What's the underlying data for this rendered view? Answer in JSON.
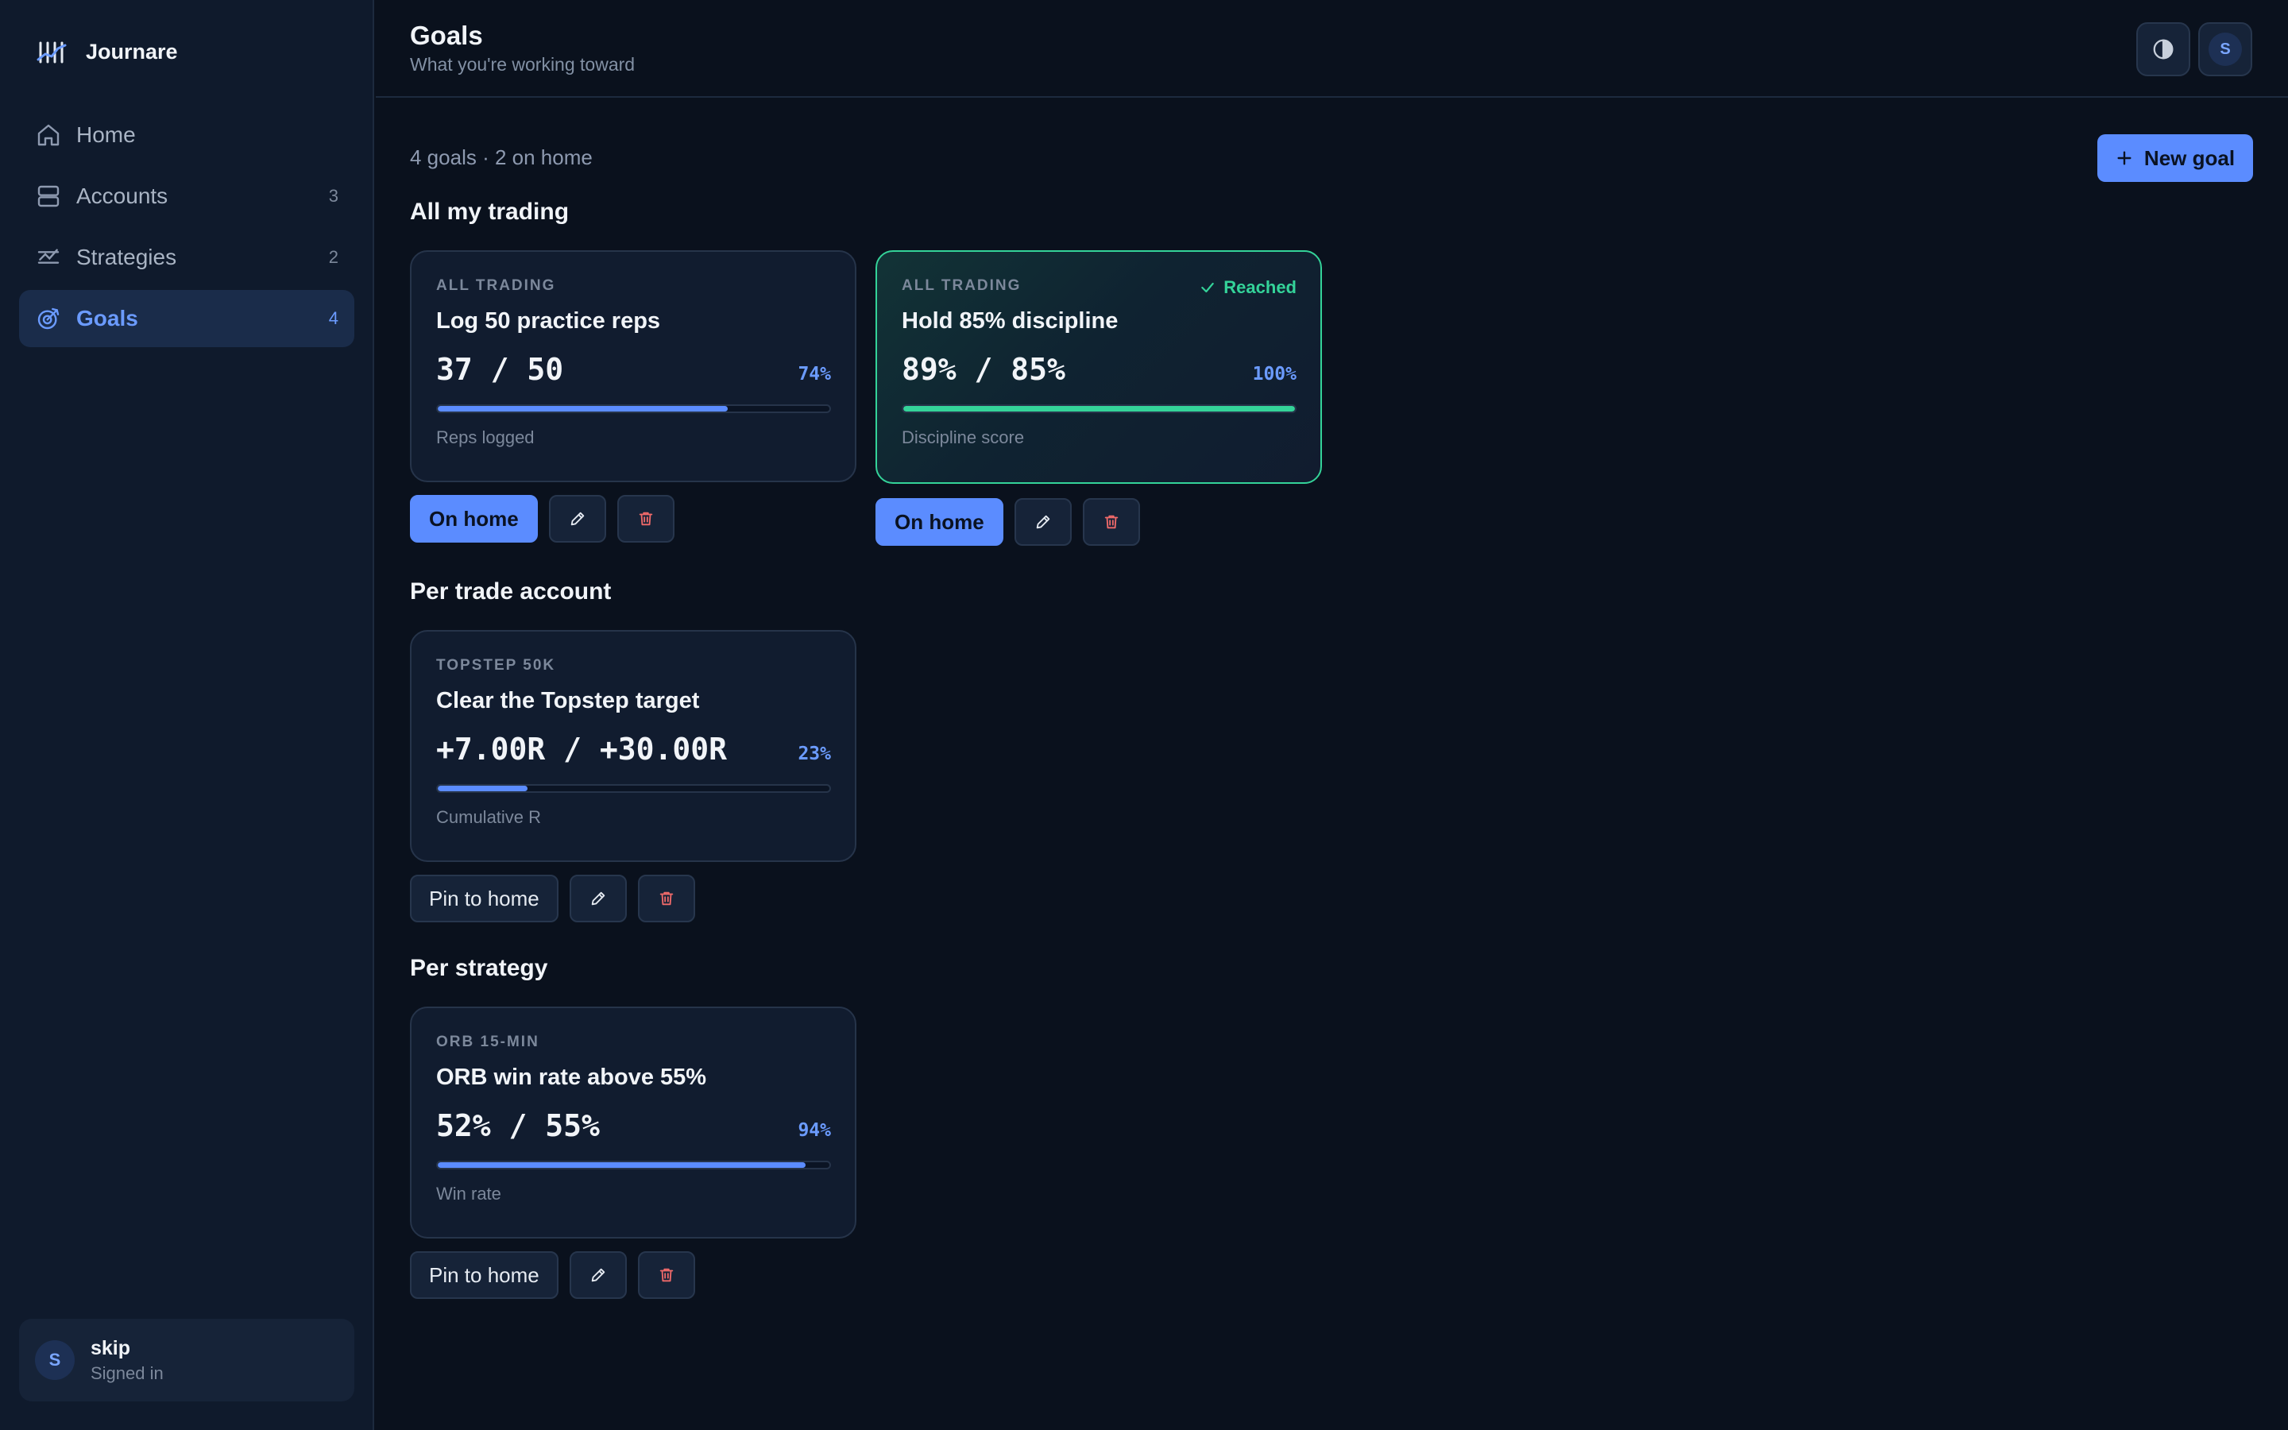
{
  "app": {
    "name": "Journare"
  },
  "sidebar": {
    "items": [
      {
        "label": "Home",
        "count": "",
        "icon": "home-icon"
      },
      {
        "label": "Accounts",
        "count": "3",
        "icon": "accounts-icon"
      },
      {
        "label": "Strategies",
        "count": "2",
        "icon": "strategies-icon"
      },
      {
        "label": "Goals",
        "count": "4",
        "icon": "goals-icon",
        "active": true
      }
    ],
    "user": {
      "initial": "S",
      "name": "skip",
      "status": "Signed in"
    }
  },
  "header": {
    "title": "Goals",
    "subtitle": "What you're working toward",
    "avatar_initial": "S"
  },
  "main": {
    "summary": "4 goals · 2 on home",
    "new_goal_label": "New goal",
    "sections": [
      {
        "title": "All my trading"
      },
      {
        "title": "Per trade account"
      },
      {
        "title": "Per strategy"
      }
    ],
    "goals": [
      {
        "scope": "ALL TRADING",
        "title": "Log 50 practice reps",
        "values": "37 / 50",
        "percent": "74%",
        "progress": 0.74,
        "metric": "Reps logged",
        "pin_label": "On home",
        "pinned": true,
        "reached": false
      },
      {
        "scope": "ALL TRADING",
        "title": "Hold 85% discipline",
        "values": "89% / 85%",
        "percent": "100%",
        "progress": 1.0,
        "metric": "Discipline score",
        "pin_label": "On home",
        "pinned": true,
        "reached": true,
        "reached_label": "Reached"
      },
      {
        "scope": "TOPSTEP 50K",
        "title": "Clear the Topstep target",
        "values": "+7.00R / +30.00R",
        "percent": "23%",
        "progress": 0.23,
        "metric": "Cumulative R",
        "pin_label": "Pin to home",
        "pinned": false,
        "reached": false
      },
      {
        "scope": "ORB 15-MIN",
        "title": "ORB win rate above 55%",
        "values": "52% / 55%",
        "percent": "94%",
        "progress": 0.94,
        "metric": "Win rate",
        "pin_label": "Pin to home",
        "pinned": false,
        "reached": false
      }
    ]
  },
  "colors": {
    "accent": "#5b8cff",
    "success": "#34d399",
    "danger": "#f06a6a",
    "background": "#0a111d",
    "sidebar": "#0f1a2c"
  }
}
